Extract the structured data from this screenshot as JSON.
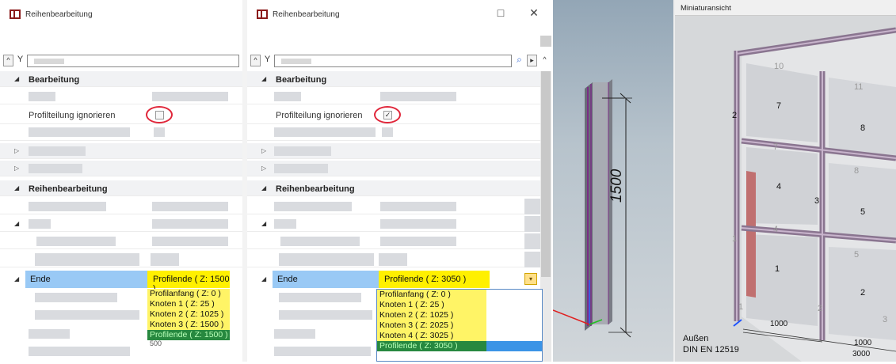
{
  "panel_left": {
    "title": "Reihenbearbeitung",
    "section_edit": "Bearbeitung",
    "row_ignore_label": "Profilteilung ignorieren",
    "checkbox_checked": false,
    "section_series": "Reihenbearbeitung",
    "end_label": "Ende",
    "end_value": "Profilende ( Z: 1500 )",
    "dropdown_options": [
      "Profilanfang ( Z: 0 )",
      "Knoten 1 ( Z: 25 )",
      "Knoten 2 ( Z: 1025 )",
      "Knoten 3 ( Z: 1500 )",
      "Profilende ( Z: 1500 )"
    ],
    "hidden_value": "500"
  },
  "panel_right": {
    "title": "Reihenbearbeitung",
    "restore_icon": "□",
    "close_icon": "✕",
    "section_edit": "Bearbeitung",
    "row_ignore_label": "Profilteilung ignorieren",
    "checkbox_checked": true,
    "checkbox_mark": "✓",
    "section_series": "Reihenbearbeitung",
    "end_label": "Ende",
    "end_value": "Profilende ( Z: 3050 )",
    "dropdown_options": [
      "Profilanfang ( Z: 0 )",
      "Knoten 1 ( Z: 25 )",
      "Knoten 2 ( Z: 1025 )",
      "Knoten 3 ( Z: 2025 )",
      "Knoten 4 ( Z: 3025 )",
      "Profilende ( Z: 3050 )"
    ]
  },
  "viewport_profile": {
    "dimension": "1500"
  },
  "miniature": {
    "title": "Miniaturansicht",
    "caption_line1": "Außen",
    "caption_line2": "DIN EN 12519",
    "node_labels": [
      "10",
      "11",
      "7",
      "8",
      "7",
      "8",
      "4",
      "5",
      "4",
      "5",
      "3",
      "2",
      "1",
      "2",
      "1",
      "1",
      "2",
      "3"
    ],
    "dim_labels": [
      "1000",
      "1000",
      "3000"
    ]
  },
  "colors": {
    "selection_blue": "#99c9f5",
    "highlight_yellow": "#fff000",
    "dropdown_green": "#27883f",
    "annotation_red": "#e0263a"
  }
}
